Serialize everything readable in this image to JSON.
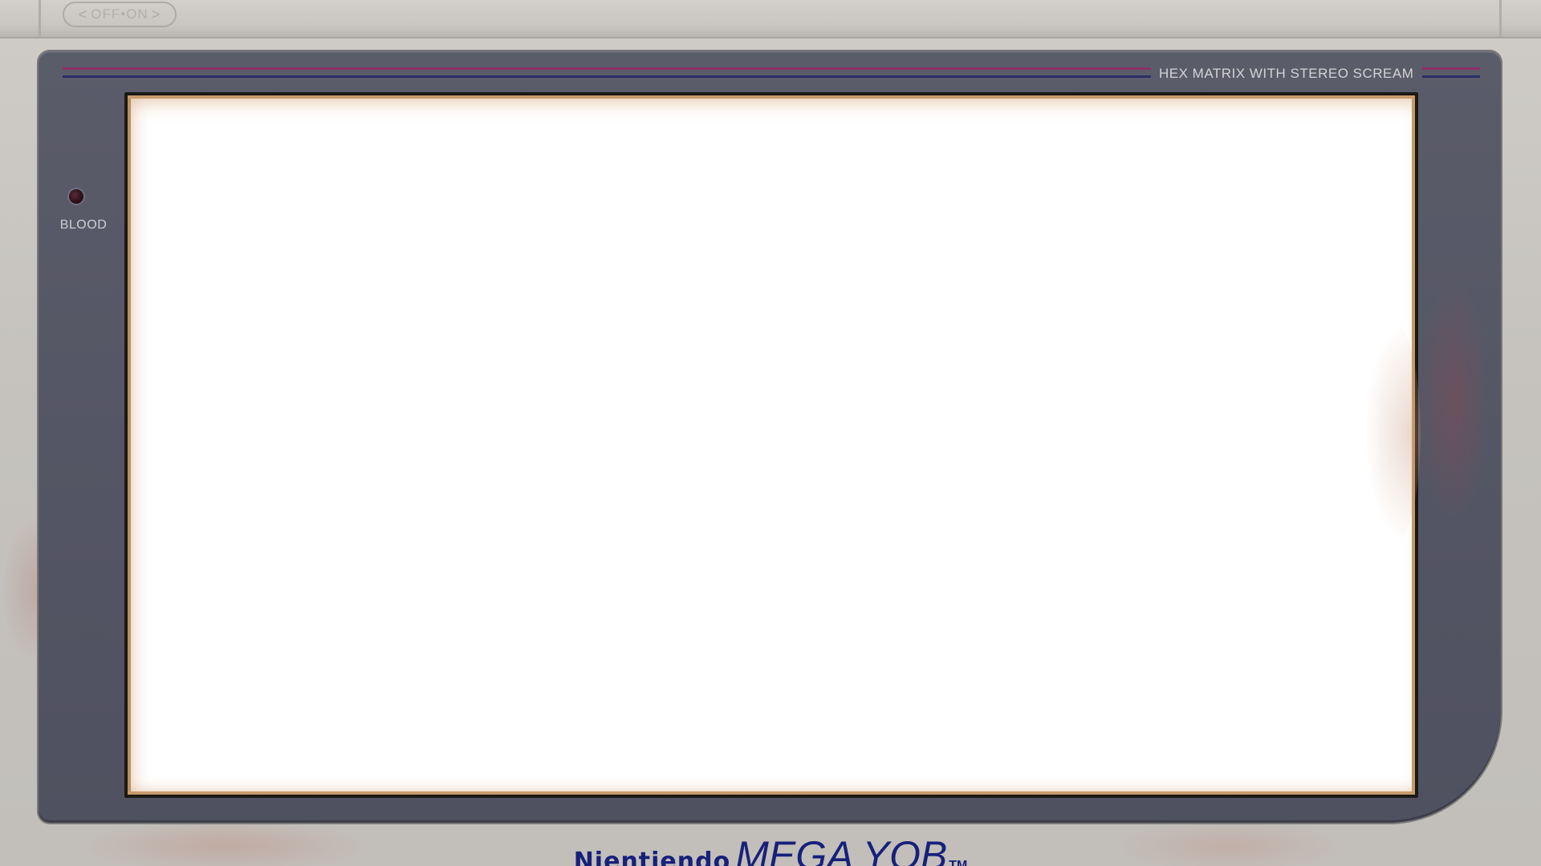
{
  "power_switch": {
    "left_arrow": "<",
    "label": "OFF•ON",
    "right_arrow": ">"
  },
  "bezel": {
    "title": "HEX MATRIX WITH STEREO SCREAM",
    "led_label": "BLOOD"
  },
  "brand": {
    "maker": "Nientiendo",
    "model": "MEGA YOB",
    "trademark": "TM"
  },
  "colors": {
    "body": "#c6c3be",
    "bezel": "#555665",
    "stripe_magenta": "#8e2f67",
    "stripe_navy": "#2a2f66",
    "brand_text": "#17207a",
    "screen": "#ffffff"
  }
}
